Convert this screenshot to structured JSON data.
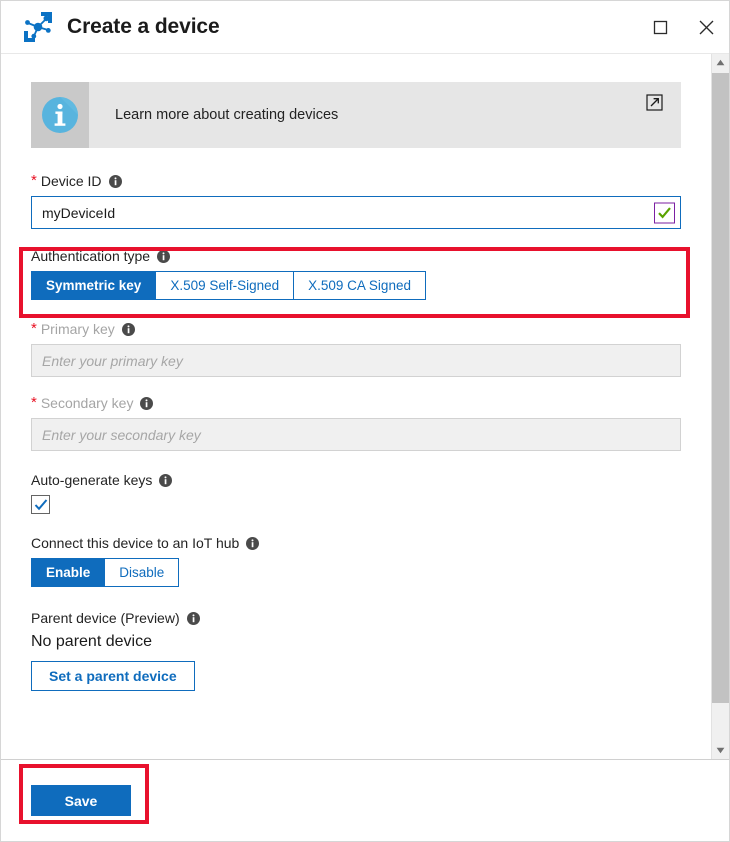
{
  "window": {
    "title": "Create a device",
    "app_icon": "iot-device-icon",
    "maximize_label": "Maximize",
    "close_label": "Close"
  },
  "info_banner": {
    "icon": "info-circle-icon",
    "text": "Learn more about creating devices",
    "link_icon": "external-link-icon"
  },
  "fields": {
    "device_id": {
      "label": "Device ID",
      "required": true,
      "required_marker": "*",
      "info_icon": "info-icon",
      "value": "myDeviceId",
      "validation_icon": "checkmark-icon",
      "valid": true,
      "focused": true
    },
    "authentication_type": {
      "label": "Authentication type",
      "info_icon": "info-icon",
      "options": [
        {
          "label": "Symmetric key",
          "selected": true
        },
        {
          "label": "X.509 Self-Signed",
          "selected": false
        },
        {
          "label": "X.509 CA Signed",
          "selected": false
        }
      ]
    },
    "primary_key": {
      "label": "Primary key",
      "required": true,
      "required_marker": "*",
      "info_icon": "info-icon",
      "value": "",
      "placeholder": "Enter your primary key",
      "disabled": true
    },
    "secondary_key": {
      "label": "Secondary key",
      "required": true,
      "required_marker": "*",
      "info_icon": "info-icon",
      "value": "",
      "placeholder": "Enter your secondary key",
      "disabled": true
    },
    "auto_generate_keys": {
      "label": "Auto-generate keys",
      "info_icon": "info-icon",
      "checked": true,
      "check_icon": "checkmark-icon"
    },
    "connect_to_hub": {
      "label": "Connect this device to an IoT hub",
      "info_icon": "info-icon",
      "options": [
        {
          "label": "Enable",
          "selected": true
        },
        {
          "label": "Disable",
          "selected": false
        }
      ]
    },
    "parent_device": {
      "label": "Parent device (Preview)",
      "info_icon": "info-icon",
      "value": "No parent device",
      "button_label": "Set a parent device"
    }
  },
  "footer": {
    "save_label": "Save"
  },
  "scrollbar": {
    "up_arrow_icon": "chevron-up-icon",
    "down_arrow_icon": "chevron-down-icon"
  },
  "colors": {
    "accent_blue": "#0f6cbd",
    "required_red": "#e81123",
    "annotation_red": "#e8112d",
    "valid_green": "#5ba300",
    "validation_box_purple": "#7b1fa2",
    "banner_bg": "#e6e6e6",
    "banner_icon_bg": "#c9c9c9",
    "info_icon_blue": "#4fa8d8",
    "disabled_field_bg": "#f0f0f0"
  }
}
